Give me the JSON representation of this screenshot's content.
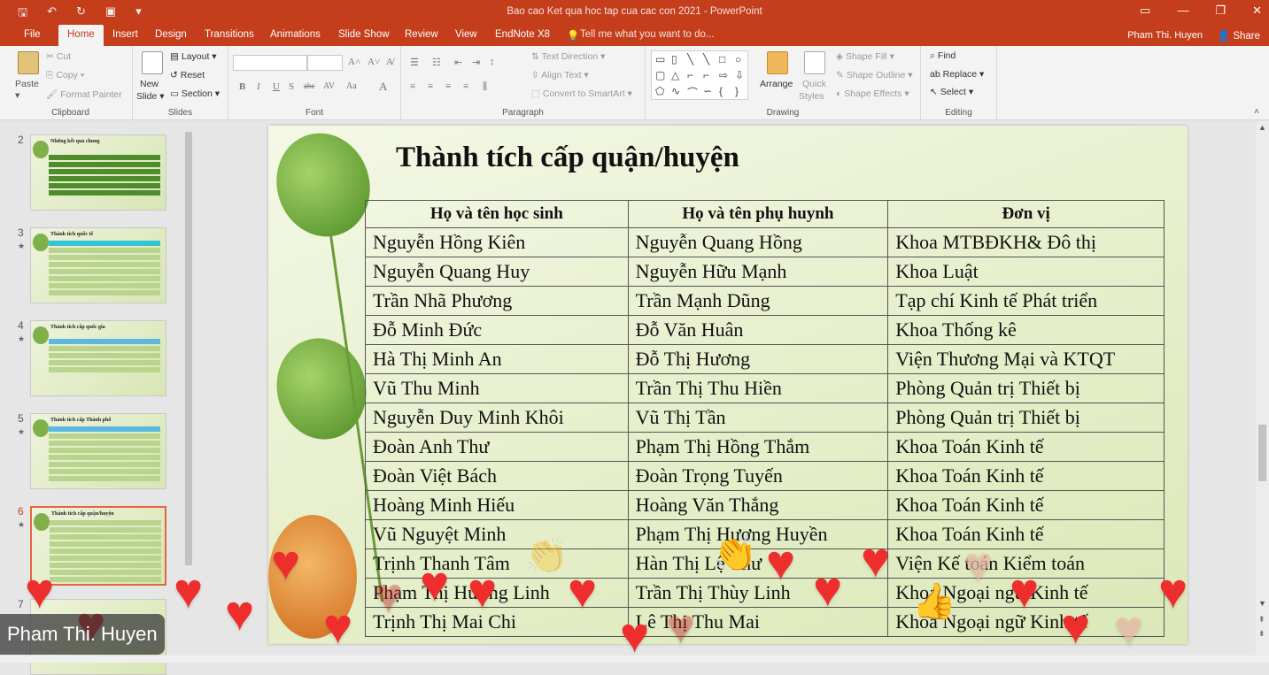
{
  "window": {
    "title": "Bao cao Ket qua hoc tap cua cac con 2021 - PowerPoint"
  },
  "tabs": [
    {
      "label": "File"
    },
    {
      "label": "Home"
    },
    {
      "label": "Insert"
    },
    {
      "label": "Design"
    },
    {
      "label": "Transitions"
    },
    {
      "label": "Animations"
    },
    {
      "label": "Slide Show"
    },
    {
      "label": "Review"
    },
    {
      "label": "View"
    },
    {
      "label": "EndNote X8"
    },
    {
      "label": "Tell me what you want to do..."
    }
  ],
  "user": {
    "name": "Pham Thi. Huyen",
    "share": "Share"
  },
  "ribbon": {
    "clipboard": {
      "label": "Clipboard",
      "paste": "Paste",
      "cut": "Cut",
      "copy": "Copy",
      "format_painter": "Format Painter"
    },
    "slides": {
      "label": "Slides",
      "new_slide_1": "New",
      "new_slide_2": "Slide",
      "layout": "Layout",
      "reset": "Reset",
      "section": "Section"
    },
    "font": {
      "label": "Font"
    },
    "paragraph": {
      "label": "Paragraph",
      "text_direction": "Text Direction",
      "align_text": "Align Text",
      "convert": "Convert to SmartArt"
    },
    "drawing": {
      "label": "Drawing",
      "arrange": "Arrange",
      "quick_styles_1": "Quick",
      "quick_styles_2": "Styles",
      "shape_fill": "Shape Fill",
      "shape_outline": "Shape Outline",
      "shape_effects": "Shape Effects"
    },
    "editing": {
      "label": "Editing",
      "find": "Find",
      "replace": "Replace",
      "select": "Select"
    }
  },
  "thumbnails": [
    {
      "num": "2",
      "title": "Những kết quả chung",
      "star": ""
    },
    {
      "num": "3",
      "title": "Thành tích quốc tế",
      "star": "★"
    },
    {
      "num": "4",
      "title": "Thành tích cấp quốc gia",
      "star": "★"
    },
    {
      "num": "5",
      "title": "Thành tích cấp Thành phố",
      "star": "★"
    },
    {
      "num": "6",
      "title": "Thành tích cấp quận/huyện",
      "star": "★"
    },
    {
      "num": "7",
      "title": "",
      "star": ""
    }
  ],
  "presenter_name": "Pham Thi. Huyen",
  "slide": {
    "title": "Thành tích cấp quận/huyện",
    "headers": [
      "Họ và tên học sinh",
      "Họ và tên phụ huynh",
      "Đơn vị"
    ],
    "rows": [
      [
        "Nguyễn Hồng Kiên",
        "Nguyễn Quang Hồng",
        "Khoa MTBĐKH& Đô thị"
      ],
      [
        "Nguyễn Quang Huy",
        "Nguyễn Hữu Mạnh",
        "Khoa Luật"
      ],
      [
        "Trần Nhã Phương",
        "Trần Mạnh Dũng",
        "Tạp chí Kinh tế Phát triển"
      ],
      [
        "Đỗ Minh Đức",
        "Đỗ Văn Huân",
        "Khoa Thống kê"
      ],
      [
        "Hà Thị Minh An",
        "Đỗ Thị Hương",
        "Viện Thương Mại và KTQT"
      ],
      [
        "Vũ Thu Minh",
        "Trần Thị Thu Hiền",
        "Phòng Quản trị Thiết bị"
      ],
      [
        "Nguyễn Duy Minh Khôi",
        "Vũ Thị Tần",
        "Phòng Quản trị Thiết bị"
      ],
      [
        "Đoàn Anh Thư",
        "Phạm Thị Hồng Thắm",
        "Khoa Toán Kinh tế"
      ],
      [
        "Đoàn Việt Bách",
        "Đoàn Trọng Tuyến",
        "Khoa Toán Kinh tế"
      ],
      [
        "Hoàng Minh Hiếu",
        "Hoàng Văn Thắng",
        "Khoa Toán Kinh tế"
      ],
      [
        "Vũ Nguyệt Minh",
        "Phạm Thị Hương Huyền",
        "Khoa Toán Kinh tế"
      ],
      [
        "Trịnh Thanh Tâm",
        "Hàn Thị Lệ Thư",
        "Viện Kế toán Kiểm toán"
      ],
      [
        "Phạm Thị Hương Linh",
        "Trần Thị Thùy Linh",
        "Khoa Ngoại ngữ Kinh tế"
      ],
      [
        "Trịnh Thị Mai Chi",
        "Lê Thị Thu Mai",
        "Khoa Ngoại ngữ Kinh tế"
      ]
    ]
  },
  "colors": {
    "accent": "#c43e1c",
    "heart": "#ee2d2d"
  },
  "icons": {
    "save": "save-icon",
    "undo": "undo-icon",
    "redo": "redo-icon",
    "present": "present-icon",
    "heart": "heart-reaction",
    "clap": "clap-reaction"
  }
}
